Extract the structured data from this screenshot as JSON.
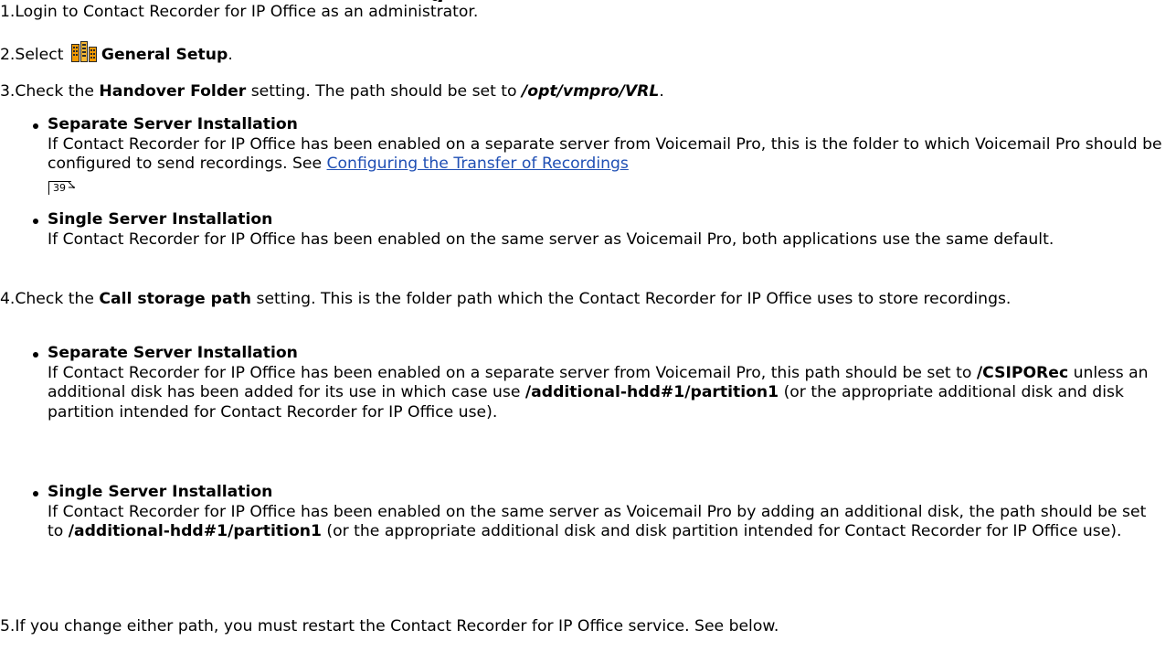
{
  "top_heading_fragment": "g",
  "steps": [
    {
      "num": "1.",
      "text": "Login to Contact Recorder for IP Office as an administrator."
    },
    {
      "num": "2.",
      "pre": "Select ",
      "bold": "General Setup",
      "post": "."
    },
    {
      "num": "3.",
      "pre": "Check the ",
      "bold": "Handover Folder",
      "mid": " setting. The path should be set to ",
      "bold_italic": "/opt/vmpro/VRL",
      "post": "."
    },
    {
      "num": "4.",
      "pre": "Check the ",
      "bold": "Call storage path",
      "post": " setting. This is the folder path which the Contact Recorder for IP Office uses to store recordings."
    },
    {
      "num": "5.",
      "text": "If you change either path, you must restart the Contact Recorder for IP Office service. See below."
    }
  ],
  "step3_bullets": [
    {
      "title": "Separate Server Installation",
      "text": "If Contact Recorder for IP Office has been enabled on a separate server from Voicemail Pro, this is the folder to which Voicemail Pro should be configured to send recordings. See ",
      "link": "Configuring the Transfer of Recordings",
      "ref": "39",
      "post": "."
    },
    {
      "title": "Single Server Installation",
      "text": "If Contact Recorder for IP Office has been enabled on the same server as Voicemail Pro, both applications use the same default."
    }
  ],
  "step4_bullets": [
    {
      "title": "Separate Server Installation",
      "text_a": "If Contact Recorder for IP Office has been enabled on a separate server from Voicemail Pro, this path should be set to ",
      "bold_a": "/CSIPORec",
      "text_b": " unless an additional disk has been added for its use in which case use ",
      "bold_b": "/additional-hdd#1/partition1",
      "text_c": " (or the appropriate additional disk and disk partition intended for Contact Recorder for IP Office use)."
    },
    {
      "title": "Single Server Installation",
      "text_a": "If Contact Recorder for IP Office has been enabled on the same server as Voicemail Pro by adding an additional disk, the path should be set to ",
      "bold_a": "/additional-hdd#1/partition1",
      "text_b": " (or the appropriate additional disk and disk partition intended for Contact Recorder for IP Office use)."
    }
  ],
  "colors": {
    "link": "#1f4fb4",
    "icon_orange": "#f29a00",
    "icon_dark": "#2a2a2a"
  },
  "icons": {
    "general_setup": "general-setup-icon",
    "xref": "page-ref-arrow-icon"
  }
}
